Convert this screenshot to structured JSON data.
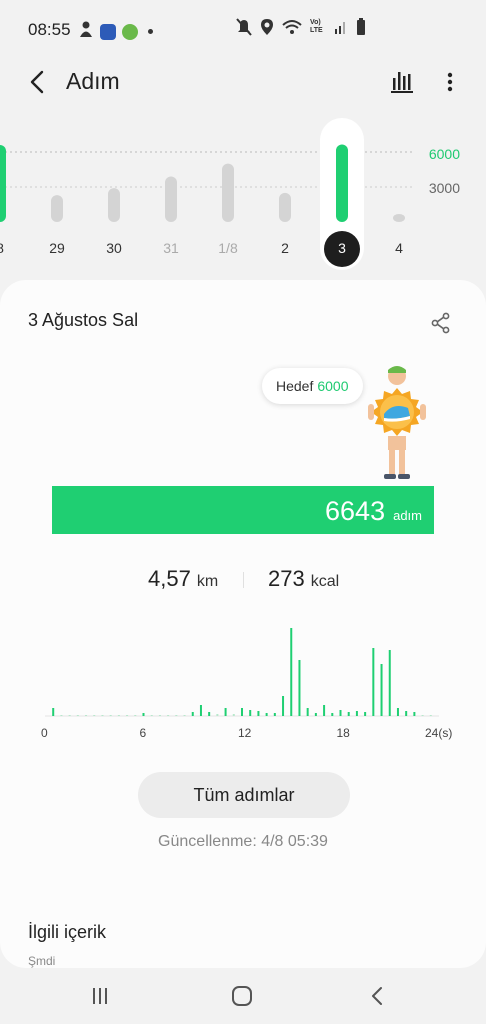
{
  "status_bar": {
    "time": "08:55",
    "icons_left": [
      "person-icon",
      "chat-app-icon",
      "home-app-icon",
      "notification-dot"
    ],
    "icons_right": [
      "mute-icon",
      "location-icon",
      "wifi-icon",
      "volte-icon",
      "signal-icon",
      "battery-icon"
    ],
    "volte_text": "Vo) LTE"
  },
  "app_bar": {
    "title": "Adım",
    "icons": [
      "back-arrow-icon",
      "bar-chart-icon",
      "more-vert-icon"
    ]
  },
  "week_strip": {
    "goal_label": "6000",
    "mid_label": "3000",
    "days": [
      {
        "label": "8",
        "steps": 6600,
        "met": true,
        "dim": false
      },
      {
        "label": "29",
        "steps": 2300,
        "met": false,
        "dim": false
      },
      {
        "label": "30",
        "steps": 2900,
        "met": false,
        "dim": false
      },
      {
        "label": "31",
        "steps": 3900,
        "met": false,
        "dim": true
      },
      {
        "label": "1/8",
        "steps": 5000,
        "met": false,
        "dim": true
      },
      {
        "label": "2",
        "steps": 2500,
        "met": false,
        "dim": false
      },
      {
        "label": "3",
        "steps": 6643,
        "met": true,
        "selected": true,
        "dim": false
      },
      {
        "label": "4",
        "steps": 500,
        "met": false,
        "dim": false
      }
    ]
  },
  "card": {
    "date_title": "3 Ağustos Sal",
    "goal_bubble_label": "Hedef",
    "goal_bubble_value": "6000",
    "progress_value": "6643",
    "progress_unit": "adım",
    "progress_fraction": 1.0,
    "distance_value": "4,57",
    "distance_unit": "km",
    "calories_value": "273",
    "calories_unit": "kcal",
    "hourly_axis_labels": [
      "0",
      "6",
      "12",
      "18",
      "24(s)"
    ],
    "all_steps_button": "Tüm adımlar",
    "updated_text": "Güncellenme: 4/8 05:39",
    "related_title": "İlgili içerik",
    "related_sub": "Şmdi"
  },
  "chart_data": {
    "type": "bar",
    "x": [
      0.5,
      1,
      1.5,
      2,
      2.5,
      3,
      3.5,
      4,
      4.5,
      5,
      5.5,
      6,
      6.5,
      7,
      7.5,
      8,
      8.5,
      9,
      9.5,
      10,
      10.5,
      11,
      11.5,
      12,
      12.5,
      13,
      13.5,
      14,
      14.5,
      15,
      15.5,
      16,
      16.5,
      17,
      17.5,
      18,
      18.5,
      19,
      19.5,
      20,
      20.5,
      21,
      21.5,
      22,
      22.5,
      23,
      23.5
    ],
    "values": [
      8,
      1,
      1,
      1,
      1,
      1,
      1,
      1,
      1,
      1,
      1,
      3,
      1,
      1,
      1,
      1,
      1,
      4,
      11,
      4,
      2,
      8,
      2,
      8,
      6,
      5,
      3,
      3,
      20,
      88,
      56,
      8,
      3,
      11,
      3,
      6,
      4,
      5,
      4,
      68,
      52,
      66,
      8,
      5,
      4,
      1,
      1
    ],
    "ylim": [
      0,
      90
    ],
    "xlim": [
      0,
      24
    ]
  },
  "colors": {
    "accent": "#1fcf72",
    "bar_grey": "#d4d4d4"
  },
  "nav_bar": {
    "icons": [
      "recent-apps-icon",
      "home-button-icon",
      "back-nav-icon"
    ]
  }
}
